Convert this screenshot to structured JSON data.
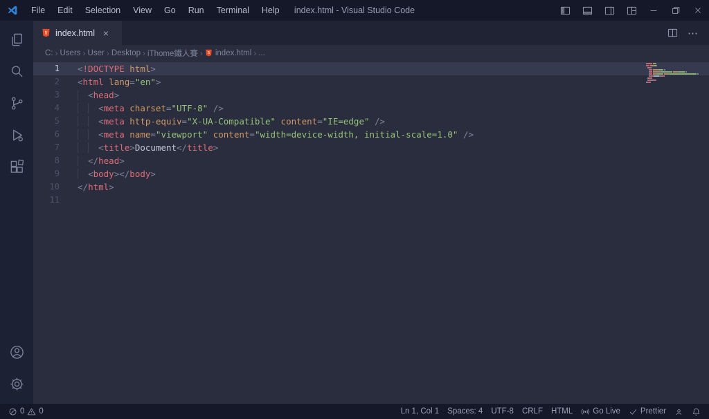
{
  "title_bar": {
    "menus": [
      "File",
      "Edit",
      "Selection",
      "View",
      "Go",
      "Run",
      "Terminal",
      "Help"
    ],
    "window_title": "index.html - Visual Studio Code"
  },
  "activity_bar": {
    "items": [
      "explorer-icon",
      "search-icon",
      "source-control-icon",
      "run-debug-icon",
      "extensions-icon"
    ],
    "bottom_items": [
      "accounts-icon",
      "settings-gear-icon"
    ]
  },
  "tab": {
    "label": "index.html",
    "close_glyph": "×"
  },
  "editor_actions": {
    "more_glyph": "⋯"
  },
  "breadcrumb": {
    "separator": "›",
    "items": [
      "C:",
      "Users",
      "User",
      "Desktop",
      "iThome鐵人賽",
      "index.html",
      "..."
    ]
  },
  "editor": {
    "lines": [
      {
        "n": "1",
        "active": true,
        "tokens": [
          [
            "<",
            "punct"
          ],
          [
            "!DOCTYPE",
            "tag"
          ],
          [
            " ",
            "ws"
          ],
          [
            "html",
            "attr"
          ],
          [
            ">",
            "punct"
          ]
        ]
      },
      {
        "n": "2",
        "tokens": [
          [
            "<",
            "punct"
          ],
          [
            "html",
            "tag"
          ],
          [
            " ",
            "ws"
          ],
          [
            "lang",
            "attr"
          ],
          [
            "=",
            "punct"
          ],
          [
            "\"en\"",
            "string"
          ],
          [
            ">",
            "punct"
          ]
        ]
      },
      {
        "n": "3",
        "tokens": [
          [
            "  ",
            "ws"
          ],
          [
            "<",
            "punct"
          ],
          [
            "head",
            "tag"
          ],
          [
            ">",
            "punct"
          ]
        ]
      },
      {
        "n": "4",
        "tokens": [
          [
            "    ",
            "ws"
          ],
          [
            "<",
            "punct"
          ],
          [
            "meta",
            "tag"
          ],
          [
            " ",
            "ws"
          ],
          [
            "charset",
            "attr"
          ],
          [
            "=",
            "punct"
          ],
          [
            "\"UTF-8\"",
            "string"
          ],
          [
            " ",
            "ws"
          ],
          [
            "/>",
            "punct"
          ]
        ]
      },
      {
        "n": "5",
        "tokens": [
          [
            "    ",
            "ws"
          ],
          [
            "<",
            "punct"
          ],
          [
            "meta",
            "tag"
          ],
          [
            " ",
            "ws"
          ],
          [
            "http-equiv",
            "attr"
          ],
          [
            "=",
            "punct"
          ],
          [
            "\"X-UA-Compatible\"",
            "string"
          ],
          [
            " ",
            "ws"
          ],
          [
            "content",
            "attr"
          ],
          [
            "=",
            "punct"
          ],
          [
            "\"IE=edge\"",
            "string"
          ],
          [
            " ",
            "ws"
          ],
          [
            "/>",
            "punct"
          ]
        ]
      },
      {
        "n": "6",
        "tokens": [
          [
            "    ",
            "ws"
          ],
          [
            "<",
            "punct"
          ],
          [
            "meta",
            "tag"
          ],
          [
            " ",
            "ws"
          ],
          [
            "name",
            "attr"
          ],
          [
            "=",
            "punct"
          ],
          [
            "\"viewport\"",
            "string"
          ],
          [
            " ",
            "ws"
          ],
          [
            "content",
            "attr"
          ],
          [
            "=",
            "punct"
          ],
          [
            "\"width=device-width, initial-scale=1.0\"",
            "string"
          ],
          [
            " ",
            "ws"
          ],
          [
            "/>",
            "punct"
          ]
        ]
      },
      {
        "n": "7",
        "tokens": [
          [
            "    ",
            "ws"
          ],
          [
            "<",
            "punct"
          ],
          [
            "title",
            "tag"
          ],
          [
            ">",
            "punct"
          ],
          [
            "Document",
            "plain"
          ],
          [
            "</",
            "punct"
          ],
          [
            "title",
            "tag"
          ],
          [
            ">",
            "punct"
          ]
        ]
      },
      {
        "n": "8",
        "tokens": [
          [
            "  ",
            "ws"
          ],
          [
            "</",
            "punct"
          ],
          [
            "head",
            "tag"
          ],
          [
            ">",
            "punct"
          ]
        ]
      },
      {
        "n": "9",
        "tokens": [
          [
            "  ",
            "ws"
          ],
          [
            "<",
            "punct"
          ],
          [
            "body",
            "tag"
          ],
          [
            ">",
            "punct"
          ],
          [
            "</",
            "punct"
          ],
          [
            "body",
            "tag"
          ],
          [
            ">",
            "punct"
          ]
        ]
      },
      {
        "n": "10",
        "tokens": [
          [
            "</",
            "punct"
          ],
          [
            "html",
            "tag"
          ],
          [
            ">",
            "punct"
          ]
        ]
      },
      {
        "n": "11",
        "tokens": []
      }
    ]
  },
  "status_bar": {
    "errors": "0",
    "warnings": "0",
    "cursor": "Ln 1, Col 1",
    "indentation": "Spaces: 4",
    "encoding": "UTF-8",
    "eol": "CRLF",
    "language": "HTML",
    "go_live": "Go Live",
    "prettier": "Prettier"
  },
  "colors": {
    "vscode_blue": "#2c84d7",
    "html_icon_orange": "#e44d26",
    "tag": "#e06c75",
    "attribute": "#d19a66",
    "string": "#98c379",
    "punctuation": "#7e8699",
    "editor_bg": "#292d3e",
    "chrome_bg": "#141828"
  }
}
